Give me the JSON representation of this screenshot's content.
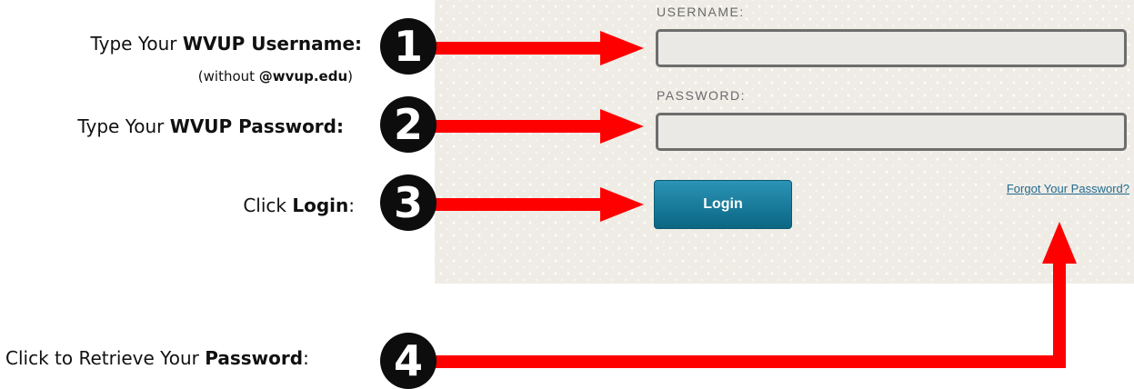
{
  "form": {
    "username_label": "USERNAME:",
    "password_label": "PASSWORD:",
    "username_value": "",
    "password_value": "",
    "login_label": "Login",
    "forgot_link": "Forgot Your Password?"
  },
  "instructions": [
    {
      "prefix": "Type Your ",
      "bold": "WVUP Username:",
      "suffix": ""
    },
    {
      "prefix": "Type Your ",
      "bold": "WVUP Password:",
      "suffix": ""
    },
    {
      "prefix": "Click ",
      "bold": "Login",
      "suffix": ":"
    },
    {
      "prefix": "Click to Retrieve Your ",
      "bold": "Password",
      "suffix": ":"
    }
  ],
  "username_note": {
    "prefix": "(without ",
    "bold": "@wvup.edu",
    "suffix": ")"
  },
  "steps": [
    "1",
    "2",
    "3",
    "4"
  ],
  "colors": {
    "arrow": "#ff0000",
    "login_button": "#117a9b",
    "link": "#246b8f",
    "step_circle": "#0d0d0d"
  }
}
